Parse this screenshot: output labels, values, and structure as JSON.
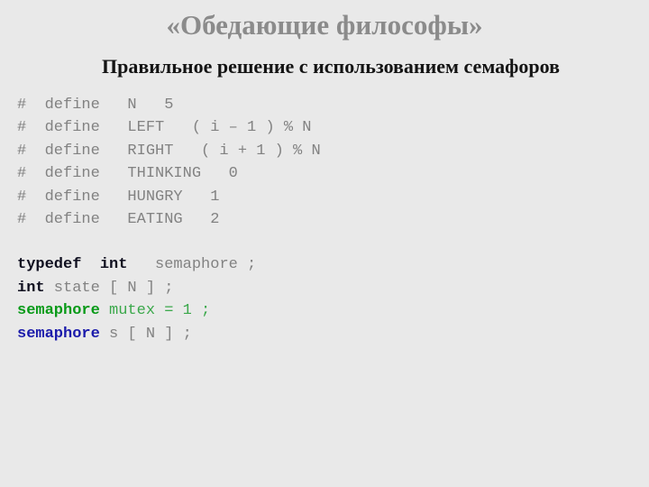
{
  "slide": {
    "background_color": "#e9e9e9",
    "title": "«Обедающие философы»",
    "title_color": "#8b8b8b",
    "subtitle": "Правильное решение с использованием семафоров",
    "subtitle_color": "#141414"
  },
  "palette": {
    "code_gray": "#828282",
    "keyword_dark": "#101020",
    "green_bold": "#089a18",
    "green_plain": "#3aa84a",
    "blue_bold": "#1b1bab"
  },
  "code": {
    "language": "c",
    "lines": [
      {
        "id": "define-n",
        "tokens": [
          {
            "text": "#  define   N   5",
            "style": "gray"
          }
        ]
      },
      {
        "id": "define-left",
        "tokens": [
          {
            "text": "#  define   LEFT   ( i – 1 ) % N",
            "style": "gray"
          }
        ]
      },
      {
        "id": "define-right",
        "tokens": [
          {
            "text": "#  define   RIGHT   ( i + 1 ) % N",
            "style": "gray"
          }
        ]
      },
      {
        "id": "define-thinking",
        "tokens": [
          {
            "text": "#  define   THINKING   0",
            "style": "gray"
          }
        ]
      },
      {
        "id": "define-hungry",
        "tokens": [
          {
            "text": "#  define   HUNGRY   1",
            "style": "gray"
          }
        ]
      },
      {
        "id": "define-eating",
        "tokens": [
          {
            "text": "#  define   EATING   2",
            "style": "gray"
          }
        ]
      },
      {
        "id": "blank-1",
        "blank": true,
        "tokens": []
      },
      {
        "id": "typedef-semaphore",
        "tokens": [
          {
            "text": "typedef  int",
            "style": "dark"
          },
          {
            "text": "   semaphore ;",
            "style": "gray"
          }
        ]
      },
      {
        "id": "decl-state",
        "tokens": [
          {
            "text": "int",
            "style": "dark"
          },
          {
            "text": " state [ N ] ;",
            "style": "gray"
          }
        ]
      },
      {
        "id": "decl-mutex",
        "tokens": [
          {
            "text": "semaphore",
            "style": "green-bold"
          },
          {
            "text": " mutex = 1 ;",
            "style": "green"
          }
        ]
      },
      {
        "id": "decl-s-array",
        "tokens": [
          {
            "text": "semaphore",
            "style": "blue-bold"
          },
          {
            "text": " s [ N ] ;",
            "style": "gray"
          }
        ]
      }
    ]
  }
}
